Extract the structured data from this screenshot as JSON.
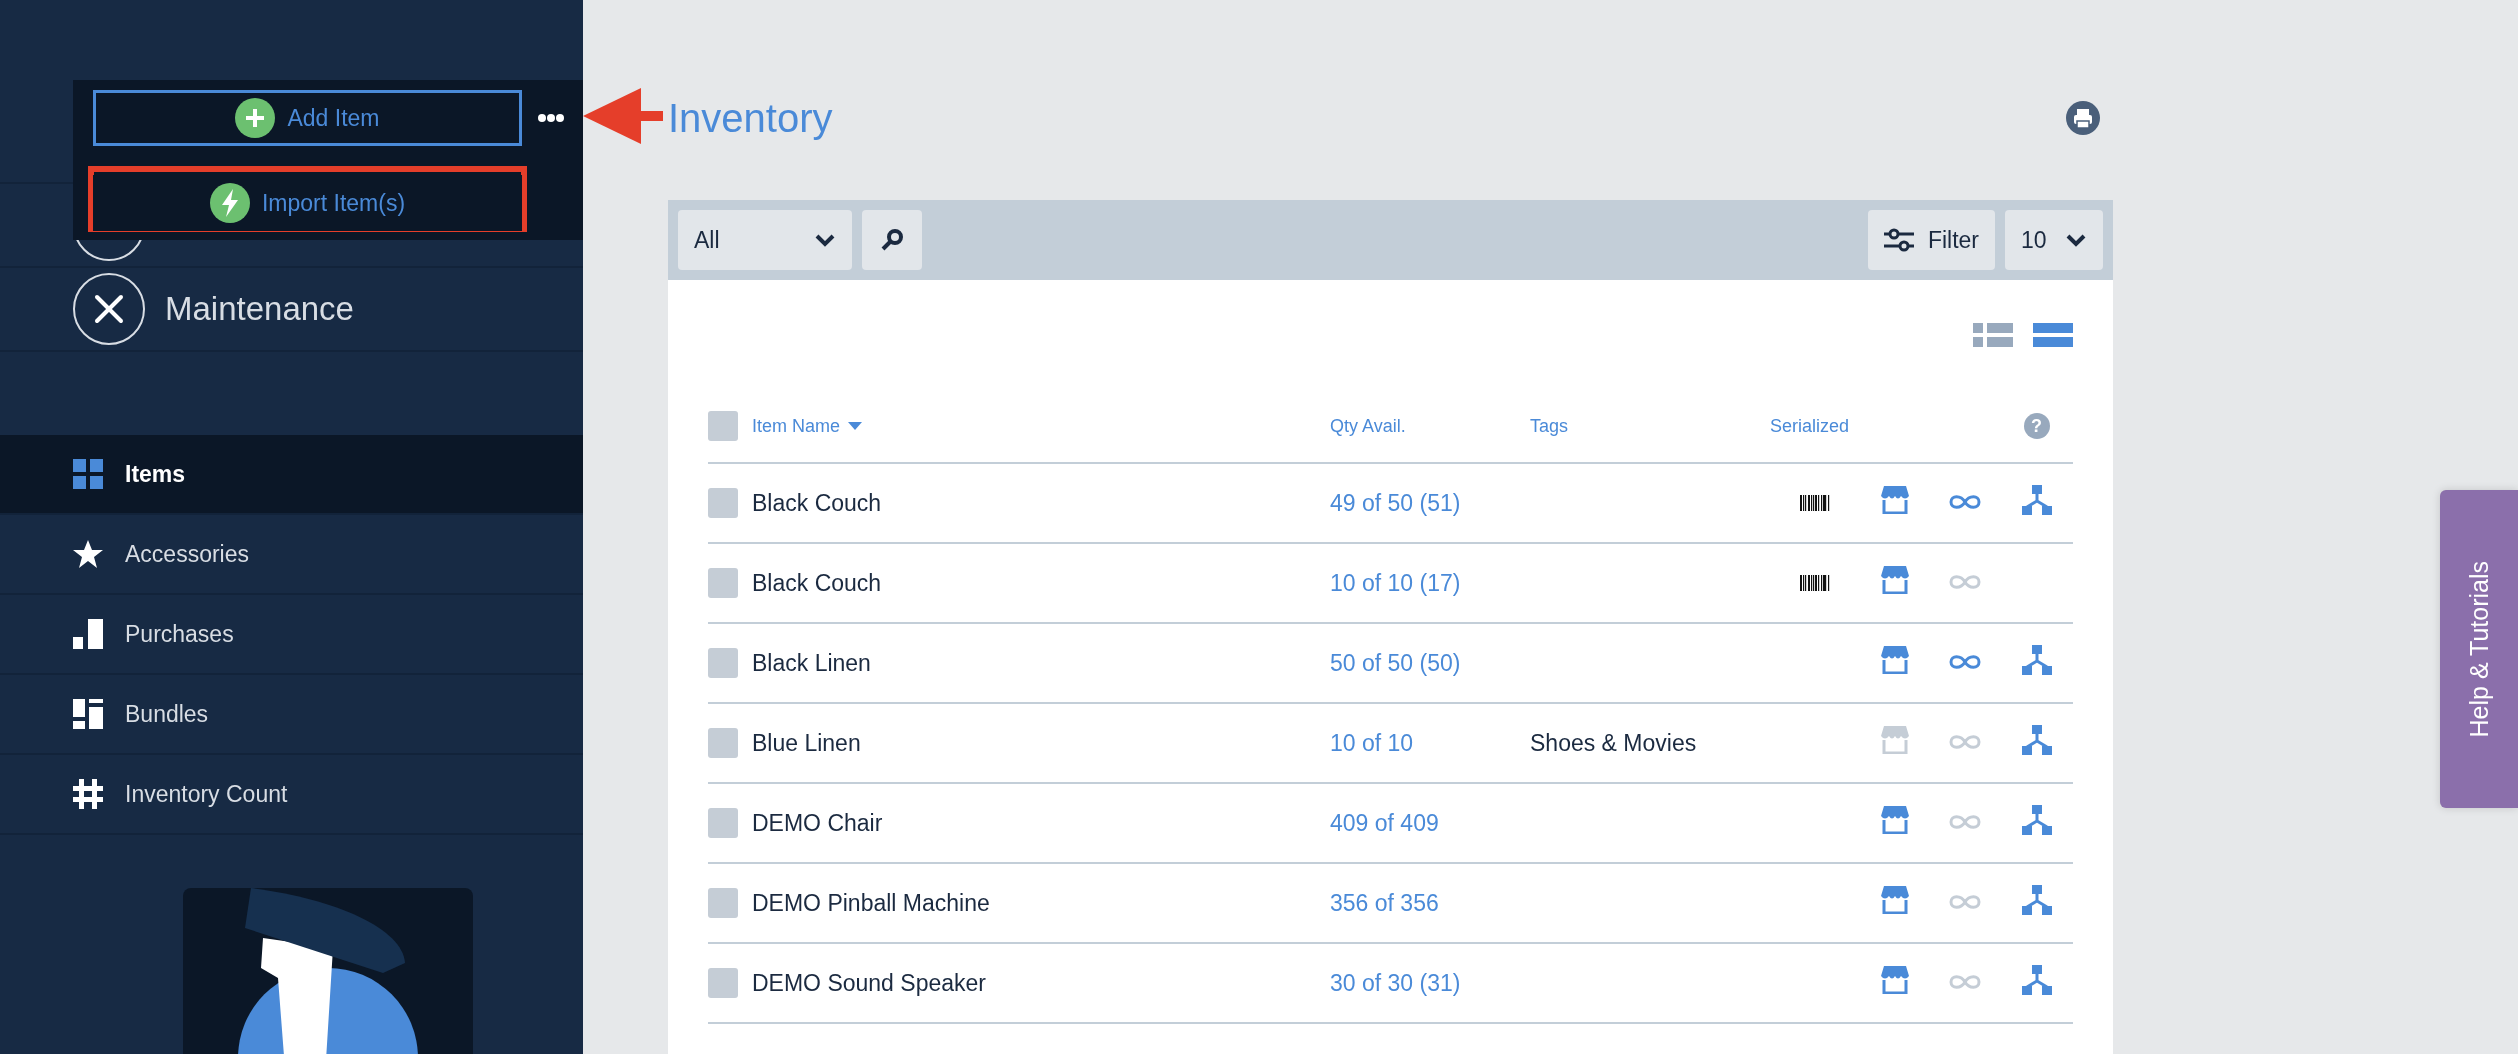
{
  "popup_menu": {
    "buttons": [
      {
        "label": "Add Item",
        "kind": "add",
        "outlined": true,
        "highlighted": false
      },
      {
        "label": "Import Item(s)",
        "kind": "import",
        "outlined": false,
        "highlighted": true
      }
    ]
  },
  "modules": [
    {
      "label": "Maintenance",
      "kind": "maintenance"
    }
  ],
  "nav": [
    {
      "label": "Items",
      "kind": "grid",
      "selected": true
    },
    {
      "label": "Accessories",
      "kind": "star",
      "selected": false
    },
    {
      "label": "Purchases",
      "kind": "bars",
      "selected": false
    },
    {
      "label": "Bundles",
      "kind": "bundles",
      "selected": false
    },
    {
      "label": "Inventory Count",
      "kind": "hash",
      "selected": false
    }
  ],
  "page_title": "Inventory",
  "toolbar": {
    "select": "All",
    "filter": "Filter",
    "per_page": "10"
  },
  "view_modes": [
    {
      "kind": "list",
      "selected": false
    },
    {
      "kind": "rows",
      "selected": true
    }
  ],
  "table": {
    "columns": [
      {
        "label": "Item Name",
        "sorted": true
      },
      {
        "label": "Qty Avail.",
        "sorted": false
      },
      {
        "label": "Tags",
        "sorted": false
      },
      {
        "label": "Serialized",
        "sorted": false
      }
    ],
    "rows": [
      {
        "name": "Black Couch",
        "qty": "49 of 50 (51)",
        "tags": "",
        "checked": false,
        "serialized": true,
        "shop": true,
        "link": true,
        "network": true
      },
      {
        "name": "Black Couch",
        "qty": "10 of 10 (17)",
        "tags": "",
        "checked": false,
        "serialized": true,
        "shop": true,
        "link": false,
        "network": false
      },
      {
        "name": "Black Linen",
        "qty": "50 of 50 (50)",
        "tags": "",
        "checked": false,
        "serialized": false,
        "shop": true,
        "link": true,
        "network": true
      },
      {
        "name": "Blue Linen",
        "qty": "10 of 10",
        "tags": "Shoes & Movies",
        "checked": false,
        "serialized": false,
        "shop": false,
        "link": false,
        "network": true
      },
      {
        "name": "DEMO Chair",
        "qty": "409 of 409",
        "tags": "",
        "checked": false,
        "serialized": false,
        "shop": true,
        "link": false,
        "network": true
      },
      {
        "name": "DEMO Pinball Machine",
        "qty": "356 of 356",
        "tags": "",
        "checked": false,
        "serialized": false,
        "shop": true,
        "link": false,
        "network": true
      },
      {
        "name": "DEMO Sound Speaker",
        "qty": "30 of 30 (31)",
        "tags": "",
        "checked": false,
        "serialized": false,
        "shop": true,
        "link": false,
        "network": true
      }
    ],
    "select_all": {
      "checked": false
    },
    "help": "?"
  },
  "help_tab": "Help & Tutorials"
}
